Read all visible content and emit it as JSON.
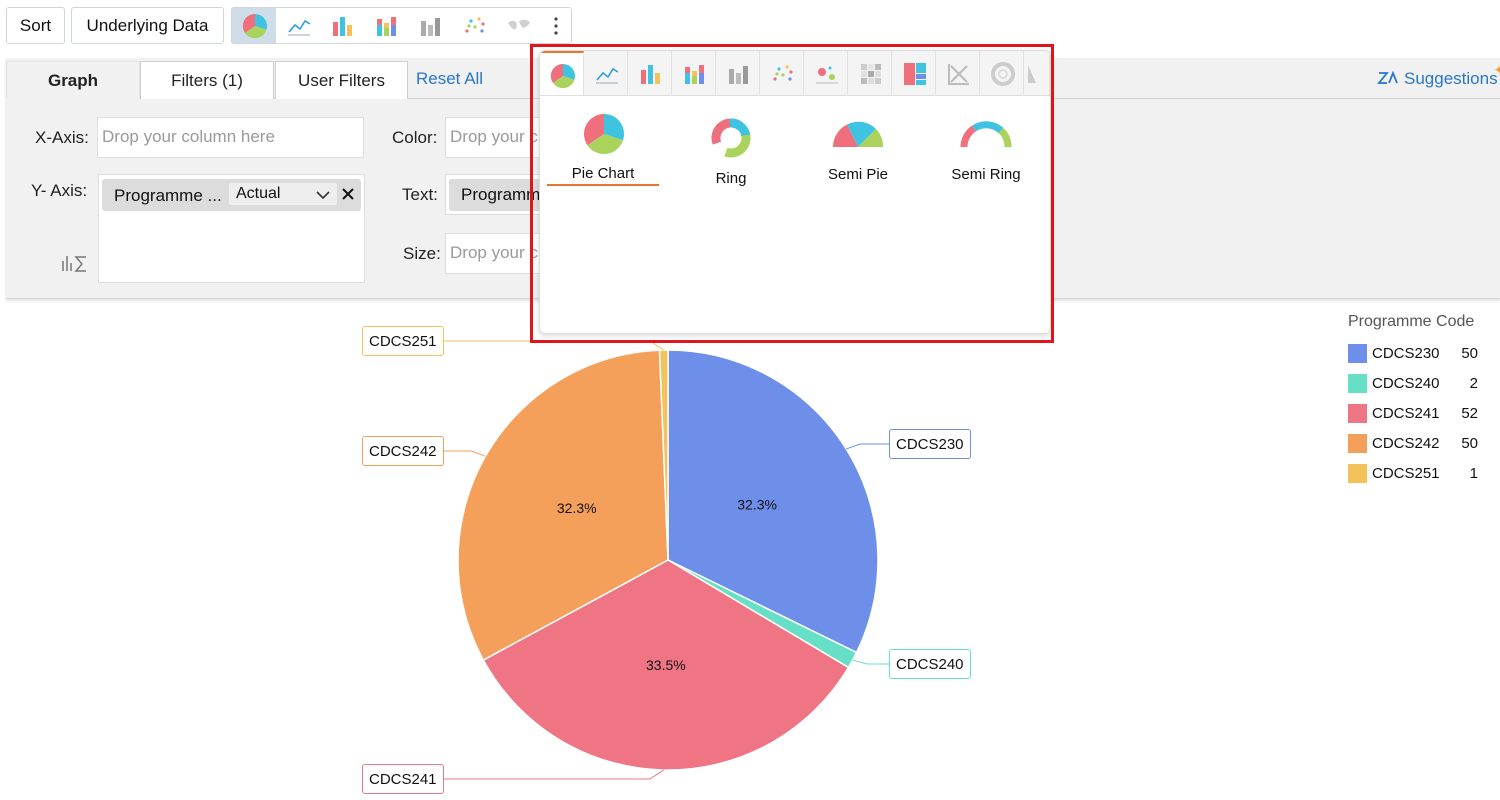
{
  "toolbar": {
    "sort_label": "Sort",
    "underlying_label": "Underlying Data",
    "chart_icons": [
      "pie-chart-icon",
      "line-chart-icon",
      "bar-chart-icon",
      "stacked-bar-icon",
      "combo-bar-icon",
      "scatter-icon",
      "map-icon",
      "more-vertical-icon"
    ]
  },
  "tabs": {
    "graph": "Graph",
    "filters": "Filters  (1)",
    "user_filters": "User Filters",
    "reset_all": "Reset All",
    "suggestions": "Suggestions"
  },
  "shelves": {
    "x_axis_label": "X-Axis:",
    "x_axis_placeholder": "Drop your column here",
    "y_axis_label": "Y- Axis:",
    "y_chip_text": "Programme ...",
    "y_chip_agg": "Actual",
    "color_label": "Color:",
    "color_placeholder": "Drop your c",
    "text_label": "Text:",
    "text_chip": "Programm",
    "size_label": "Size:",
    "size_placeholder": "Drop your c"
  },
  "chart_picker": {
    "options": [
      {
        "label": "Pie Chart"
      },
      {
        "label": "Ring"
      },
      {
        "label": "Semi Pie"
      },
      {
        "label": "Semi Ring"
      }
    ]
  },
  "chart_data": {
    "type": "pie",
    "legend_title": "Programme Code",
    "series": [
      {
        "name": "CDCS230",
        "value": 50,
        "percent_label": "32.3%",
        "color": "#6e8fe9"
      },
      {
        "name": "CDCS240",
        "value": 2,
        "percent_label": "",
        "color": "#66dfc6"
      },
      {
        "name": "CDCS241",
        "value": 52,
        "percent_label": "33.5%",
        "color": "#ef7584"
      },
      {
        "name": "CDCS242",
        "value": 50,
        "percent_label": "32.3%",
        "color": "#f4a05a"
      },
      {
        "name": "CDCS251",
        "value": 1,
        "percent_label": "",
        "color": "#f3c25a"
      }
    ]
  }
}
